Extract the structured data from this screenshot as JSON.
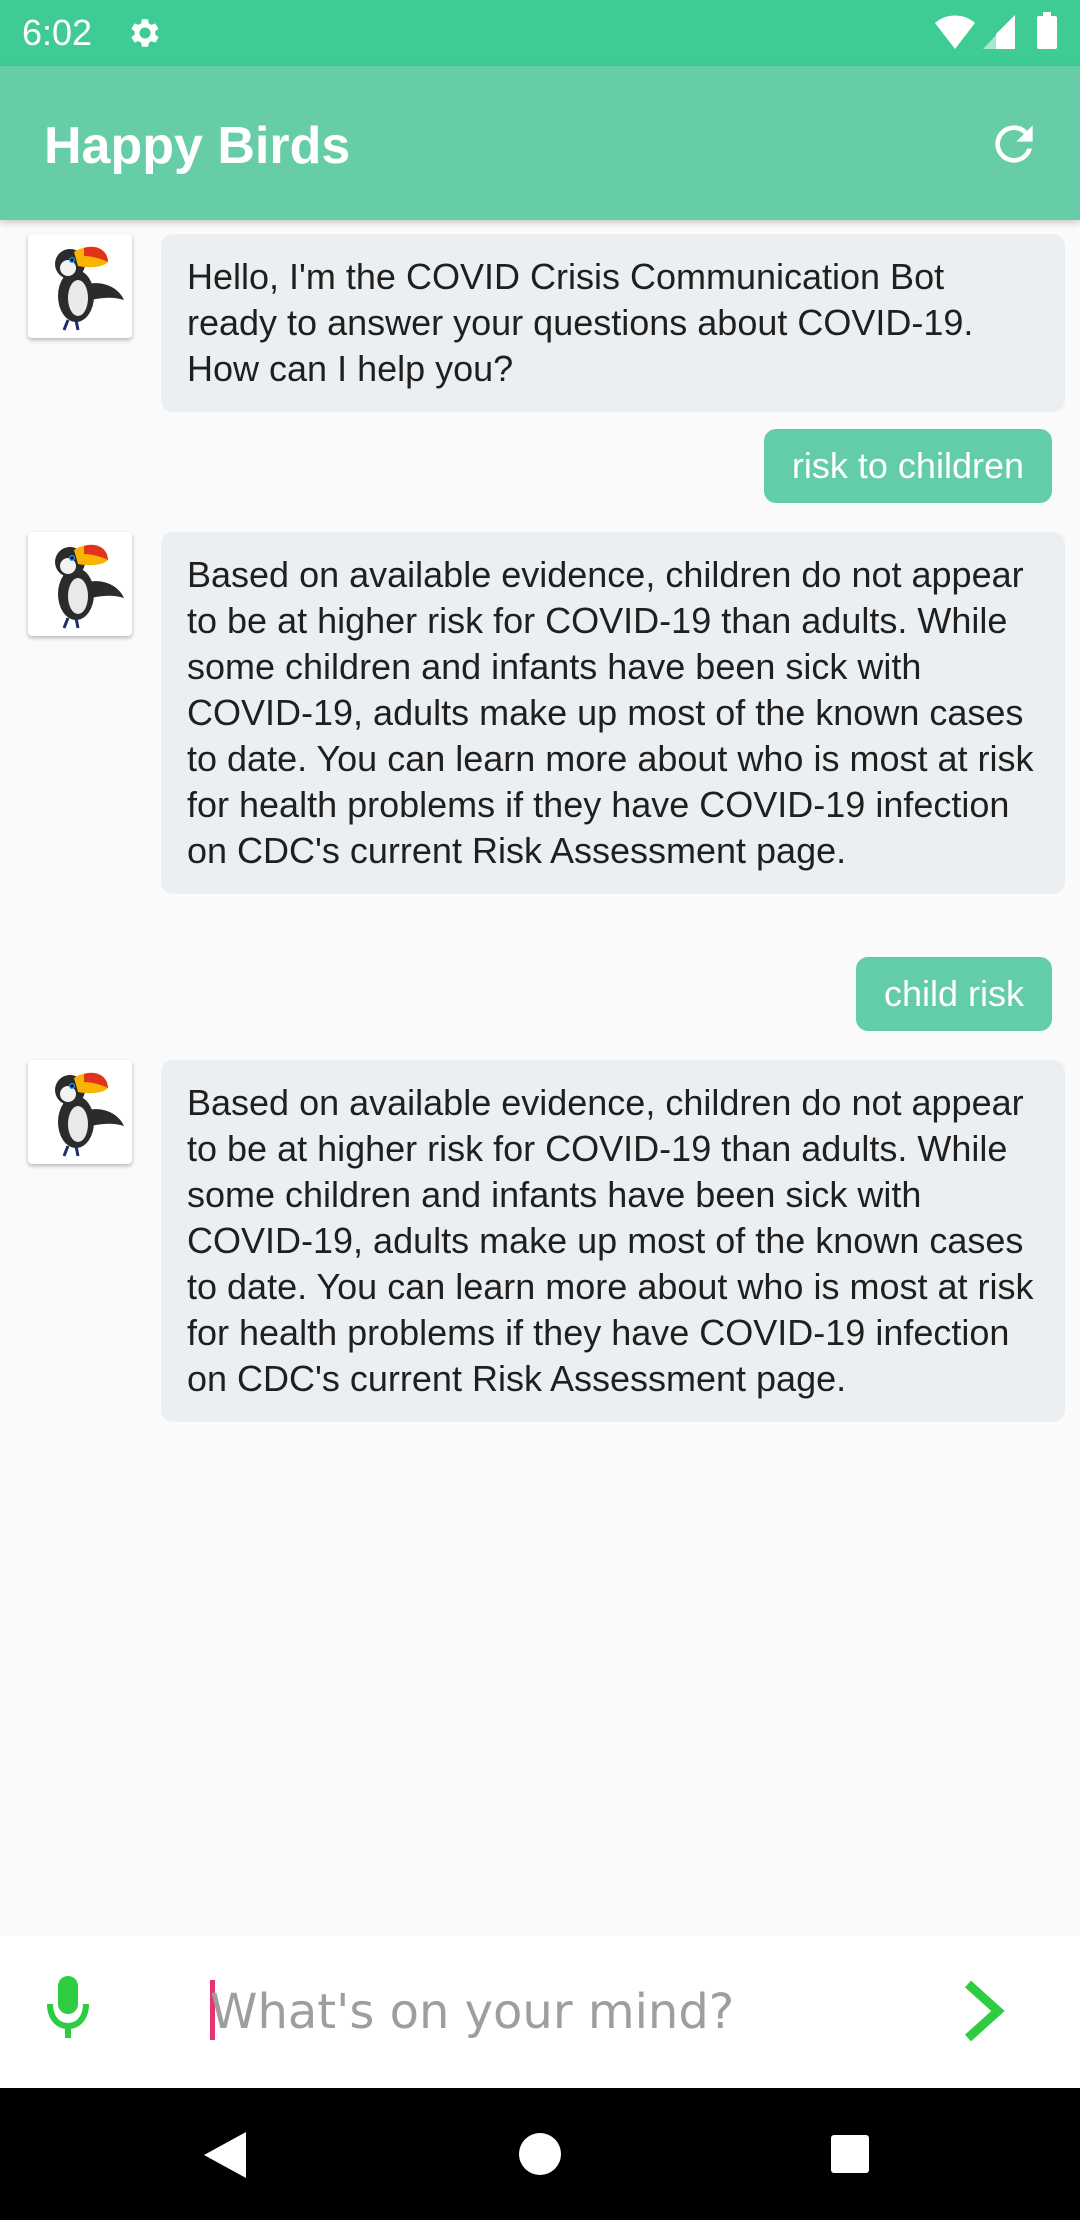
{
  "status_bar": {
    "time": "6:02",
    "background": "#3fcb94"
  },
  "app_bar": {
    "title": "Happy Birds",
    "background": "#66cda7",
    "refresh_icon": "refresh-icon"
  },
  "messages": [
    {
      "sender": "bot",
      "text": "Hello, I'm the COVID Crisis Communication Bot ready to answer your questions about COVID-19. How can I help you?"
    },
    {
      "sender": "user",
      "text": "risk to children"
    },
    {
      "sender": "bot",
      "text": "Based on available evidence, children do not appear to be at higher risk for COVID-19 than adults. While some children and infants have been sick with COVID-19, adults make up most of the known cases to date. You can learn more about who is most at risk for health problems if they have COVID-19 infection on CDC's current Risk Assessment page."
    },
    {
      "sender": "user",
      "text": "child risk"
    },
    {
      "sender": "bot",
      "text": "Based on available evidence, children do not appear to be at higher risk for COVID-19 than adults. While some children and infants have been sick with COVID-19, adults make up most of the known cases to date. You can learn more about who is most at risk for health problems if they have COVID-19 infection on CDC's current Risk Assessment page."
    }
  ],
  "input_bar": {
    "placeholder": "What's on your mind?",
    "value": "",
    "mic_icon": "mic-icon",
    "send_icon": "chevron-right-icon",
    "accent_color": "#2ecc40"
  },
  "colors": {
    "bot_bubble": "#eceff1",
    "user_bubble": "#62cda6",
    "background": "#fafafa"
  }
}
